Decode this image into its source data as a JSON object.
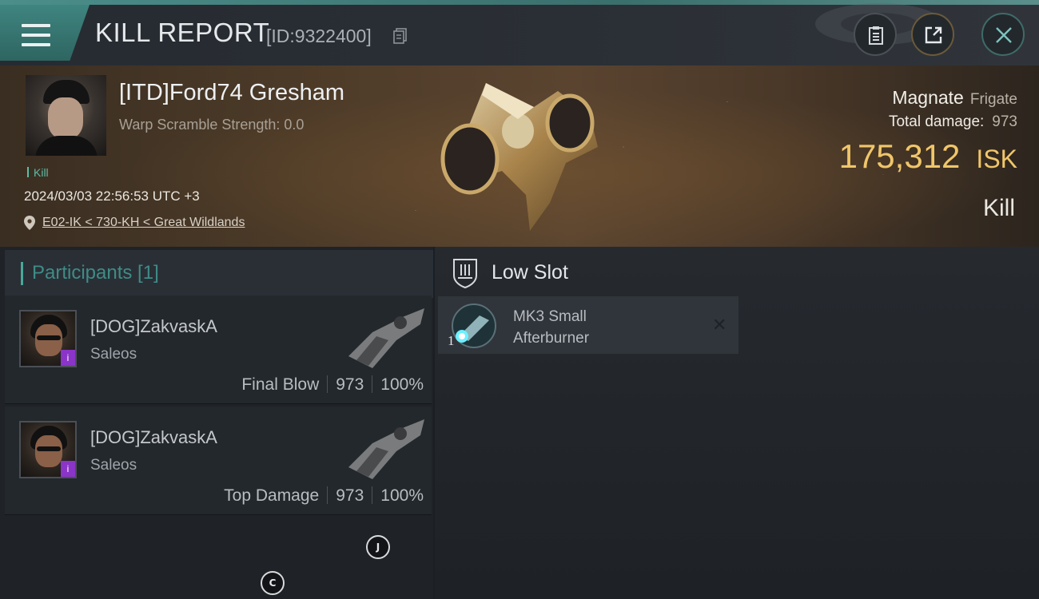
{
  "header_bar": {
    "title": "KILL REPORT",
    "report_id": "[ID:9322400]"
  },
  "victim": {
    "name": "[ITD]Ford74 Gresham",
    "warp_scramble": "Warp Scramble Strength: 0.0",
    "kill_tag": "Kill",
    "datetime": "2024/03/03 22:56:53 UTC +3",
    "location": "E02-IK < 730-KH < Great Wildlands"
  },
  "ship": {
    "name": "Magnate",
    "class": "Frigate",
    "total_damage_label": "Total damage:",
    "total_damage": "973",
    "isk_value": "175,312",
    "isk_unit": "ISK",
    "result": "Kill"
  },
  "participants": {
    "title": "Participants [1]",
    "items": [
      {
        "name": "[DOG]ZakvaskA",
        "ship": "Saleos",
        "role": "Final Blow",
        "damage": "973",
        "percent": "100%",
        "badge": "i"
      },
      {
        "name": "[DOG]ZakvaskA",
        "ship": "Saleos",
        "role": "Top Damage",
        "damage": "973",
        "percent": "100%",
        "badge": "i"
      }
    ]
  },
  "slots": {
    "title": "Low Slot",
    "items": [
      {
        "line1": "MK3 Small",
        "line2": "Afterburner",
        "qty": "1",
        "remove": "✕"
      }
    ]
  },
  "markers": {
    "j": "J",
    "c": "C"
  },
  "colors": {
    "accent": "#49a89a",
    "isk": "#f0c66a",
    "badge": "#8a34c8"
  },
  "icons": [
    "menu-icon",
    "copy-icon",
    "clipboard-icon",
    "share-icon",
    "close-icon",
    "pin-icon",
    "low-slot-icon",
    "afterburner-icon"
  ]
}
